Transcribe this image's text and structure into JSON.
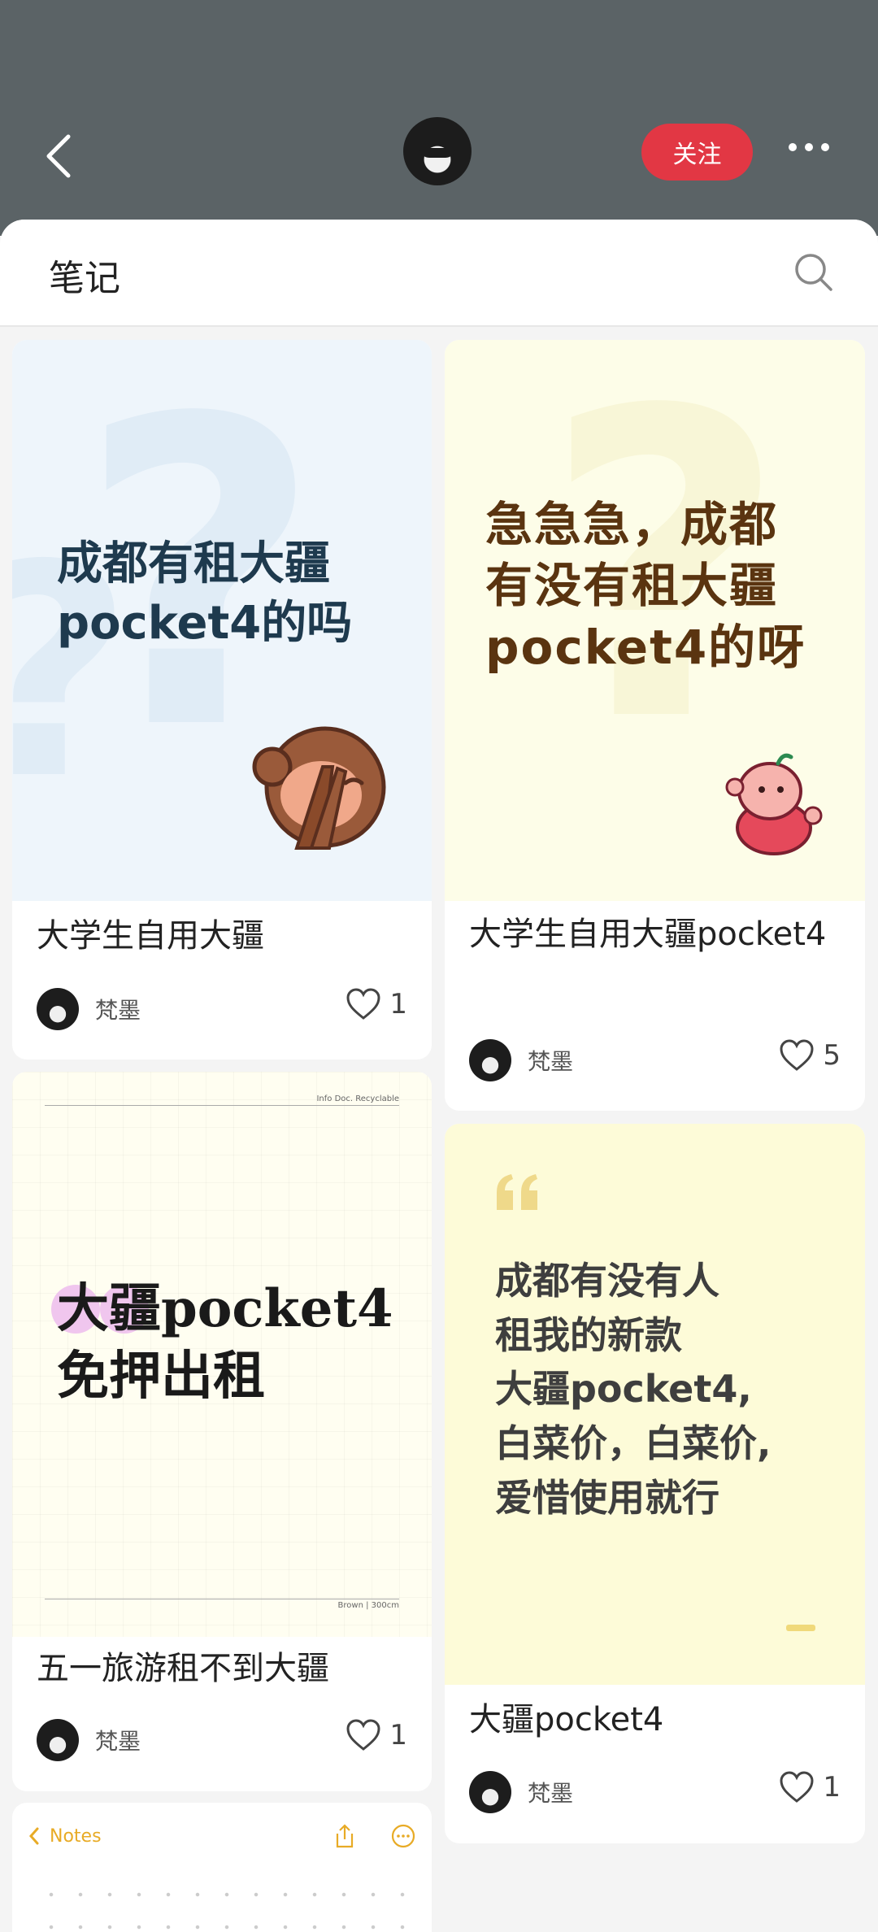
{
  "header": {
    "follow_label": "关注"
  },
  "sheet": {
    "title": "笔记"
  },
  "notes": [
    {
      "cover_lines": [
        "成都有租大疆",
        "pocket4的吗"
      ],
      "title": "大学生自用大疆",
      "author": "梵墨",
      "likes": "1"
    },
    {
      "cover_lines": [
        "急急急，成都",
        "有没有租大疆",
        "pocket4的呀"
      ],
      "title": "大学生自用大疆pocket4",
      "author": "梵墨",
      "likes": "5"
    },
    {
      "cover_lines": [
        "大疆pocket4",
        "免押出租"
      ],
      "cover_header": "Info Doc.   Recyclable",
      "cover_footer": "Brown | 300cm",
      "title": "五一旅游租不到大疆",
      "author": "梵墨",
      "likes": "1"
    },
    {
      "cover_lines": [
        "成都有没有人",
        "租我的新款",
        "大疆pocket4,",
        "白菜价，白菜价,",
        "爱惜使用就行"
      ],
      "title": "大疆pocket4",
      "author": "梵墨",
      "likes": "1"
    },
    {
      "notes_label": "Notes"
    }
  ],
  "colors": {
    "header_bg": "#5b6366",
    "follow_bg": "#e23744",
    "notes_accent": "#e8ab26"
  }
}
